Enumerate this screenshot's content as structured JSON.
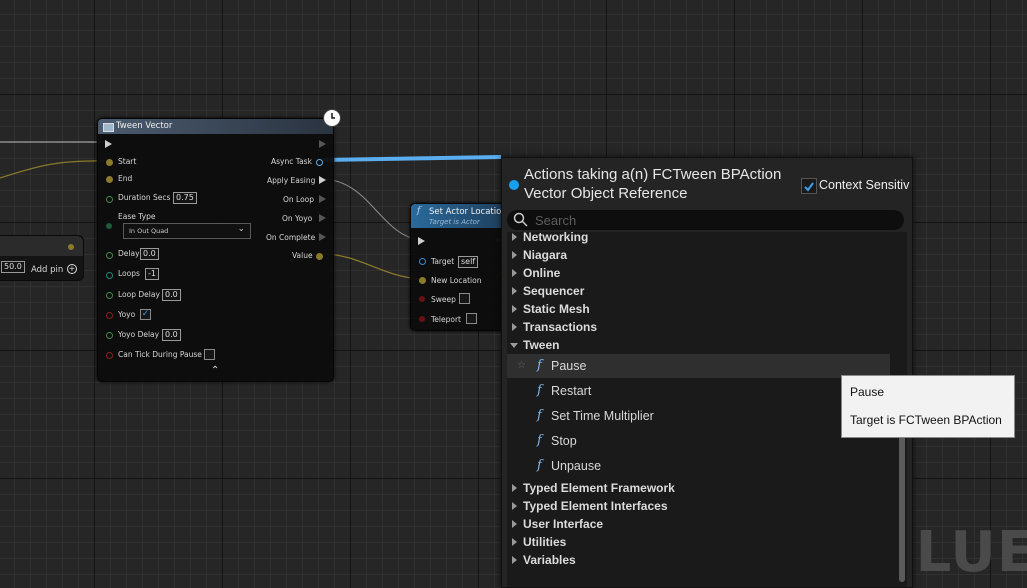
{
  "watermark": "BLUEP",
  "left_node": {
    "value": "50.0",
    "add_pin": "Add pin"
  },
  "tween_node": {
    "title": "Tween Vector",
    "inputs": {
      "start": "Start",
      "end": "End",
      "duration_label": "Duration Secs",
      "duration_value": "0.75",
      "ease_type_label": "Ease Type",
      "ease_type_value": "In Out Quad",
      "delay_label": "Delay",
      "delay_value": "0.0",
      "loops_label": "Loops",
      "loops_value": "-1",
      "loop_delay_label": "Loop Delay",
      "loop_delay_value": "0.0",
      "yoyo_label": "Yoyo",
      "yoyo_delay_label": "Yoyo Delay",
      "yoyo_delay_value": "0.0",
      "can_tick_label": "Can Tick During Pause"
    },
    "outputs": {
      "async_task": "Async Task",
      "apply_easing": "Apply Easing",
      "on_loop": "On Loop",
      "on_yoyo": "On Yoyo",
      "on_complete": "On Complete",
      "value": "Value"
    }
  },
  "set_actor_node": {
    "title": "Set Actor Location",
    "subtitle": "Target is Actor",
    "target_label": "Target",
    "target_value": "self",
    "new_location_label": "New Location",
    "sweep_label": "Sweep",
    "teleport_label": "Teleport"
  },
  "menu": {
    "title_line1": "Actions taking a(n) FCTween BPAction",
    "title_line2": "Vector Object Reference",
    "context_sensitive_label": "Context Sensitiv",
    "search_placeholder": "Search",
    "categories_top": [
      "Networking",
      "Niagara",
      "Online",
      "Sequencer",
      "Static Mesh",
      "Transactions"
    ],
    "open_category": "Tween",
    "functions": [
      "Pause",
      "Restart",
      "Set Time Multiplier",
      "Stop",
      "Unpause"
    ],
    "categories_bottom": [
      "Typed Element Framework",
      "Typed Element Interfaces",
      "User Interface",
      "Utilities",
      "Variables"
    ]
  },
  "tooltip": {
    "line1": "Pause",
    "line2": "Target is FCTween BPAction"
  },
  "colors": {
    "accent": "#17a0f0",
    "wire_blue": "#5aaef0",
    "wire_gold": "#a08a30",
    "tween_header": "#3c4a5c",
    "set_actor_header": "#24507a"
  }
}
